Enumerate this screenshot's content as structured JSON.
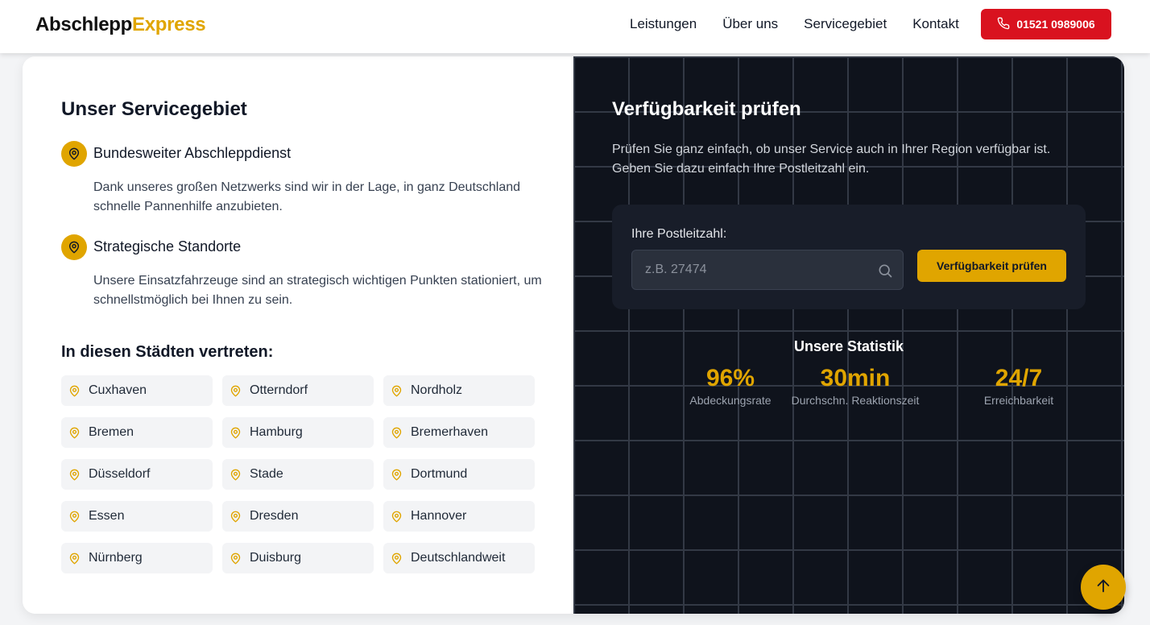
{
  "header": {
    "logo_part1": "Abschlepp",
    "logo_part2": "Express",
    "nav": [
      "Leistungen",
      "Über uns",
      "Servicegebiet",
      "Kontakt"
    ],
    "phone": "01521 0989006",
    "phone_icon": "phone-icon"
  },
  "colors": {
    "accent": "#e0a500",
    "call_red": "#d9121f",
    "dark_panel": "#0f131c"
  },
  "service": {
    "title": "Unser Servicegebiet",
    "features": [
      {
        "icon": "map-pin-icon",
        "title": "Bundesweiter Abschleppdienst",
        "text": "Dank unseres großen Netzwerks sind wir in der Lage, in ganz Deutschland schnelle Pannenhilfe anzubieten."
      },
      {
        "icon": "map-pin-icon",
        "title": "Strategische Standorte",
        "text": "Unsere Einsatzfahrzeuge sind an strategisch wichtigen Punkten stationiert, um schnellstmöglich bei Ihnen zu sein."
      }
    ],
    "cities_title": "In diesen Städten vertreten:",
    "cities": [
      "Cuxhaven",
      "Otterndorf",
      "Nordholz",
      "Bremen",
      "Hamburg",
      "Bremerhaven",
      "Düsseldorf",
      "Stade",
      "Dortmund",
      "Essen",
      "Dresden",
      "Hannover",
      "Nürnberg",
      "Duisburg",
      "Deutschlandweit"
    ]
  },
  "availability": {
    "title": "Verfügbarkeit prüfen",
    "description": "Prüfen Sie ganz einfach, ob unser Service auch in Ihrer Region verfügbar ist. Geben Sie dazu einfach Ihre Postleitzahl ein.",
    "input_label": "Ihre Postleitzahl:",
    "input_placeholder": "z.B. 27474",
    "input_value": "",
    "button_label": "Verfügbarkeit prüfen",
    "search_icon": "search-icon"
  },
  "stats": {
    "title": "Unsere Statistik",
    "items": [
      {
        "value": "96%",
        "label": "Abdeckungsrate"
      },
      {
        "value": "30min",
        "label": "Durchschn. Reaktionszeit"
      },
      {
        "value": "24/7",
        "label": "Erreichbarkeit"
      }
    ]
  },
  "scroll_top_icon": "arrow-up-icon"
}
